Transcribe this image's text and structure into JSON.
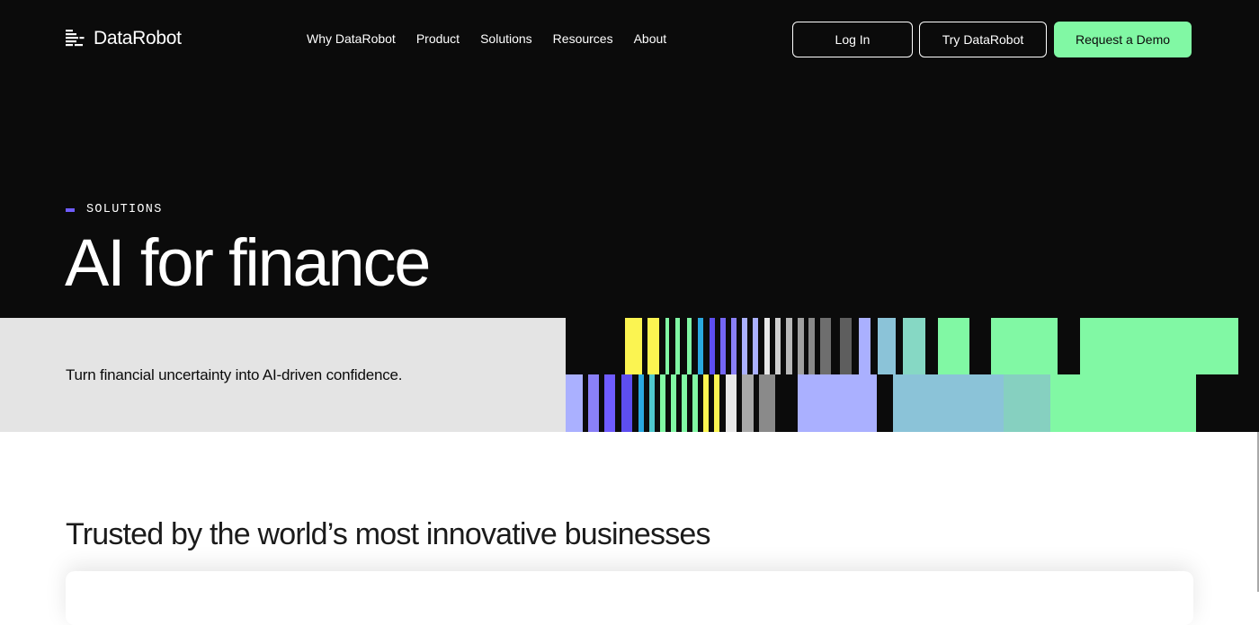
{
  "brand": {
    "name": "DataRobot",
    "icon": "datarobot-logo-icon"
  },
  "nav": {
    "links": [
      "Why DataRobot",
      "Product",
      "Solutions",
      "Resources",
      "About"
    ],
    "buttons": {
      "login": "Log In",
      "try": "Try DataRobot",
      "demo": "Request a Demo"
    }
  },
  "hero": {
    "eyebrow": "SOLUTIONS",
    "title": "AI for finance",
    "subtitle": "Turn financial uncertainty into AI-driven confidence."
  },
  "trusted": {
    "title": "Trusted by the world’s most innovative businesses"
  },
  "colors": {
    "background": "#0b0b0b",
    "accent_green": "#81f8a4",
    "accent_purple": "#6f5cff",
    "band_gray": "#e4e4e4"
  }
}
